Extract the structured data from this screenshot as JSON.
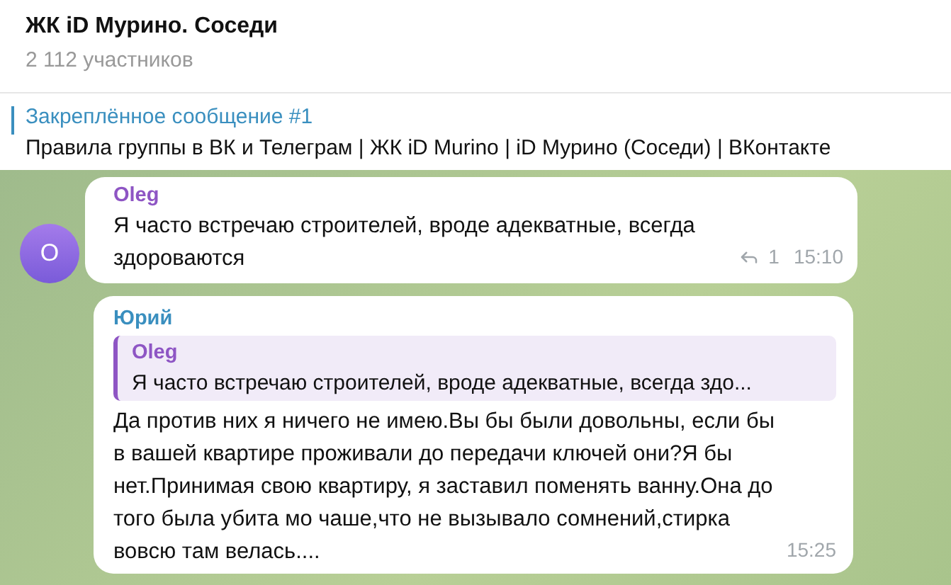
{
  "header": {
    "title": "ЖК iD Мурино. Соседи",
    "subtitle": "2 112 участников"
  },
  "pinned": {
    "title": "Закреплённое сообщение #1",
    "text": "Правила группы в ВК и Телеграм | ЖК iD Murino | iD Мурино (Соседи) | ВКонтакте"
  },
  "messages": [
    {
      "kind": "plain",
      "author": "Oleg",
      "color": "#8e55c4",
      "avatar_letter": "O",
      "text": "Я часто встречаю строителей, вроде адекватные, всегда здороваются",
      "replies": "1",
      "time": "15:10"
    },
    {
      "kind": "reply",
      "author": "Юрий",
      "color": "#3a8fbf",
      "quote": {
        "author": "Oleg",
        "color": "#8e55c4",
        "text": "Я часто встречаю строителей, вроде адекватные, всегда здо..."
      },
      "text": "Да против них я ничего не имею.Вы бы были довольны, если бы в вашей квартире проживали до передачи ключей они?Я бы нет.Принимая свою квартиру, я заставил поменять ванну.Она до того была убита мо чаше,что не вызывало сомнений,стирка вовсю там велась....",
      "time": "15:25"
    }
  ]
}
